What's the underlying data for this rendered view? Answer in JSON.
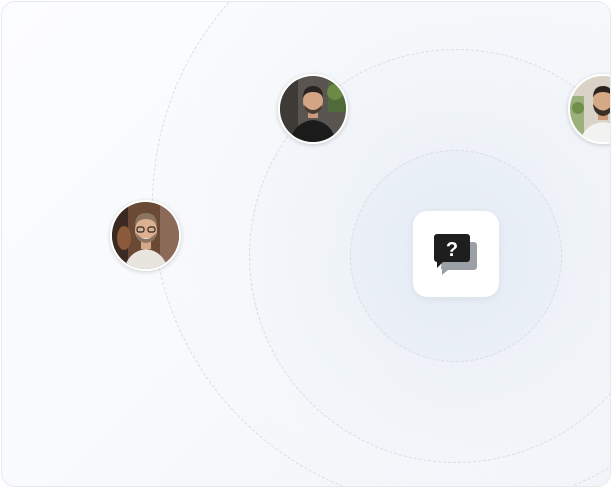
{
  "colors": {
    "card_background": "#f7f9fb",
    "ring_stroke": "#d8dde4",
    "tile_background": "#ffffff",
    "icon_primary": "#1e1e1e",
    "icon_secondary": "#9aa0a6"
  },
  "center_icon": {
    "name": "question-chat-icon",
    "glyph": "?"
  },
  "avatars": [
    {
      "name": "avatar-top",
      "icon": "person-photo"
    },
    {
      "name": "avatar-left",
      "icon": "person-photo"
    },
    {
      "name": "avatar-right",
      "icon": "person-photo"
    }
  ]
}
